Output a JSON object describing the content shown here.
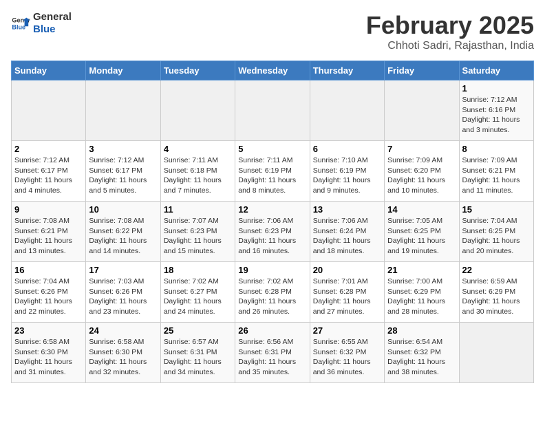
{
  "header": {
    "logo_general": "General",
    "logo_blue": "Blue",
    "title": "February 2025",
    "subtitle": "Chhoti Sadri, Rajasthan, India"
  },
  "weekdays": [
    "Sunday",
    "Monday",
    "Tuesday",
    "Wednesday",
    "Thursday",
    "Friday",
    "Saturday"
  ],
  "weeks": [
    [
      {
        "day": "",
        "detail": ""
      },
      {
        "day": "",
        "detail": ""
      },
      {
        "day": "",
        "detail": ""
      },
      {
        "day": "",
        "detail": ""
      },
      {
        "day": "",
        "detail": ""
      },
      {
        "day": "",
        "detail": ""
      },
      {
        "day": "1",
        "detail": "Sunrise: 7:12 AM\nSunset: 6:16 PM\nDaylight: 11 hours\nand 3 minutes."
      }
    ],
    [
      {
        "day": "2",
        "detail": "Sunrise: 7:12 AM\nSunset: 6:17 PM\nDaylight: 11 hours\nand 4 minutes."
      },
      {
        "day": "3",
        "detail": "Sunrise: 7:12 AM\nSunset: 6:17 PM\nDaylight: 11 hours\nand 5 minutes."
      },
      {
        "day": "4",
        "detail": "Sunrise: 7:11 AM\nSunset: 6:18 PM\nDaylight: 11 hours\nand 7 minutes."
      },
      {
        "day": "5",
        "detail": "Sunrise: 7:11 AM\nSunset: 6:19 PM\nDaylight: 11 hours\nand 8 minutes."
      },
      {
        "day": "6",
        "detail": "Sunrise: 7:10 AM\nSunset: 6:19 PM\nDaylight: 11 hours\nand 9 minutes."
      },
      {
        "day": "7",
        "detail": "Sunrise: 7:09 AM\nSunset: 6:20 PM\nDaylight: 11 hours\nand 10 minutes."
      },
      {
        "day": "8",
        "detail": "Sunrise: 7:09 AM\nSunset: 6:21 PM\nDaylight: 11 hours\nand 11 minutes."
      }
    ],
    [
      {
        "day": "9",
        "detail": "Sunrise: 7:08 AM\nSunset: 6:21 PM\nDaylight: 11 hours\nand 13 minutes."
      },
      {
        "day": "10",
        "detail": "Sunrise: 7:08 AM\nSunset: 6:22 PM\nDaylight: 11 hours\nand 14 minutes."
      },
      {
        "day": "11",
        "detail": "Sunrise: 7:07 AM\nSunset: 6:23 PM\nDaylight: 11 hours\nand 15 minutes."
      },
      {
        "day": "12",
        "detail": "Sunrise: 7:06 AM\nSunset: 6:23 PM\nDaylight: 11 hours\nand 16 minutes."
      },
      {
        "day": "13",
        "detail": "Sunrise: 7:06 AM\nSunset: 6:24 PM\nDaylight: 11 hours\nand 18 minutes."
      },
      {
        "day": "14",
        "detail": "Sunrise: 7:05 AM\nSunset: 6:25 PM\nDaylight: 11 hours\nand 19 minutes."
      },
      {
        "day": "15",
        "detail": "Sunrise: 7:04 AM\nSunset: 6:25 PM\nDaylight: 11 hours\nand 20 minutes."
      }
    ],
    [
      {
        "day": "16",
        "detail": "Sunrise: 7:04 AM\nSunset: 6:26 PM\nDaylight: 11 hours\nand 22 minutes."
      },
      {
        "day": "17",
        "detail": "Sunrise: 7:03 AM\nSunset: 6:26 PM\nDaylight: 11 hours\nand 23 minutes."
      },
      {
        "day": "18",
        "detail": "Sunrise: 7:02 AM\nSunset: 6:27 PM\nDaylight: 11 hours\nand 24 minutes."
      },
      {
        "day": "19",
        "detail": "Sunrise: 7:02 AM\nSunset: 6:28 PM\nDaylight: 11 hours\nand 26 minutes."
      },
      {
        "day": "20",
        "detail": "Sunrise: 7:01 AM\nSunset: 6:28 PM\nDaylight: 11 hours\nand 27 minutes."
      },
      {
        "day": "21",
        "detail": "Sunrise: 7:00 AM\nSunset: 6:29 PM\nDaylight: 11 hours\nand 28 minutes."
      },
      {
        "day": "22",
        "detail": "Sunrise: 6:59 AM\nSunset: 6:29 PM\nDaylight: 11 hours\nand 30 minutes."
      }
    ],
    [
      {
        "day": "23",
        "detail": "Sunrise: 6:58 AM\nSunset: 6:30 PM\nDaylight: 11 hours\nand 31 minutes."
      },
      {
        "day": "24",
        "detail": "Sunrise: 6:58 AM\nSunset: 6:30 PM\nDaylight: 11 hours\nand 32 minutes."
      },
      {
        "day": "25",
        "detail": "Sunrise: 6:57 AM\nSunset: 6:31 PM\nDaylight: 11 hours\nand 34 minutes."
      },
      {
        "day": "26",
        "detail": "Sunrise: 6:56 AM\nSunset: 6:31 PM\nDaylight: 11 hours\nand 35 minutes."
      },
      {
        "day": "27",
        "detail": "Sunrise: 6:55 AM\nSunset: 6:32 PM\nDaylight: 11 hours\nand 36 minutes."
      },
      {
        "day": "28",
        "detail": "Sunrise: 6:54 AM\nSunset: 6:32 PM\nDaylight: 11 hours\nand 38 minutes."
      },
      {
        "day": "",
        "detail": ""
      }
    ]
  ]
}
